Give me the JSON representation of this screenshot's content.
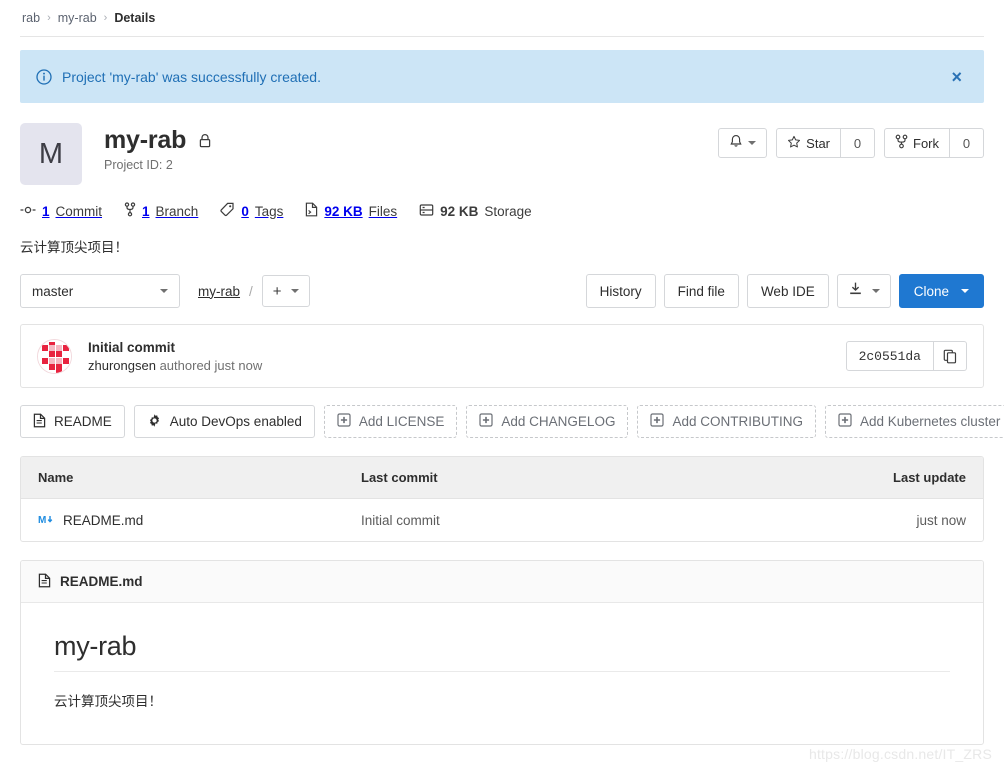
{
  "breadcrumb": {
    "group": "rab",
    "project": "my-rab",
    "current": "Details",
    "separator": "›"
  },
  "alert": {
    "icon": "info-circle-icon",
    "message": "Project 'my-rab' was successfully created.",
    "close_label": "×",
    "bg_color": "#cce5f6",
    "text_color": "#1f6fb5"
  },
  "project": {
    "avatar_letter": "M",
    "name": "my-rab",
    "visibility_icon": "lock-icon",
    "project_id_label": "Project ID: 2",
    "description": "云计算顶尖项目！"
  },
  "header_actions": {
    "notification_icon": "bell-icon",
    "star_label": "Star",
    "star_icon": "star-icon",
    "star_count": "0",
    "fork_label": "Fork",
    "fork_icon": "fork-icon",
    "fork_count": "0"
  },
  "stats": [
    {
      "icon": "commit-icon",
      "value": "1",
      "label": "Commit"
    },
    {
      "icon": "branch-icon",
      "value": "1",
      "label": "Branch"
    },
    {
      "icon": "tag-icon",
      "value": "0",
      "label": "Tags"
    },
    {
      "icon": "doc-icon",
      "value": "92 KB",
      "label": "Files"
    },
    {
      "icon": "storage-icon",
      "value": "92 KB",
      "label": "Storage"
    }
  ],
  "toolbar": {
    "branch": "master",
    "path_name": "my-rab",
    "path_separator": "/",
    "add_glyph": "+",
    "history_label": "History",
    "find_file_label": "Find file",
    "web_ide_label": "Web IDE",
    "download_icon": "download-icon",
    "clone_label": "Clone",
    "clone_color": "#1f78d1"
  },
  "commit": {
    "avatar_icon": "identicon-avatar",
    "title": "Initial commit",
    "author": "zhurongsen",
    "timing": "authored just now",
    "sha": "2c0551da",
    "copy_icon": "copy-icon"
  },
  "quick_actions": [
    {
      "label": "README",
      "icon": "doc-icon",
      "style": "solid"
    },
    {
      "label": "Auto DevOps enabled",
      "icon": "gear-icon",
      "style": "solid"
    },
    {
      "label": "Add LICENSE",
      "icon": "plus-box-icon",
      "style": "dashed"
    },
    {
      "label": "Add CHANGELOG",
      "icon": "plus-box-icon",
      "style": "dashed"
    },
    {
      "label": "Add CONTRIBUTING",
      "icon": "plus-box-icon",
      "style": "dashed"
    },
    {
      "label": "Add Kubernetes cluster",
      "icon": "plus-box-icon",
      "style": "dashed"
    }
  ],
  "file_table": {
    "headers": {
      "name": "Name",
      "last_commit": "Last commit",
      "last_update": "Last update"
    },
    "rows": [
      {
        "icon": "markdown-icon",
        "name": "README.md",
        "last_commit": "Initial commit",
        "last_update": "just now"
      }
    ]
  },
  "readme": {
    "header_icon": "doc-icon",
    "header_title": "README.md",
    "heading": "my-rab",
    "body": "云计算顶尖项目！"
  },
  "watermark": "https://blog.csdn.net/IT_ZRS"
}
